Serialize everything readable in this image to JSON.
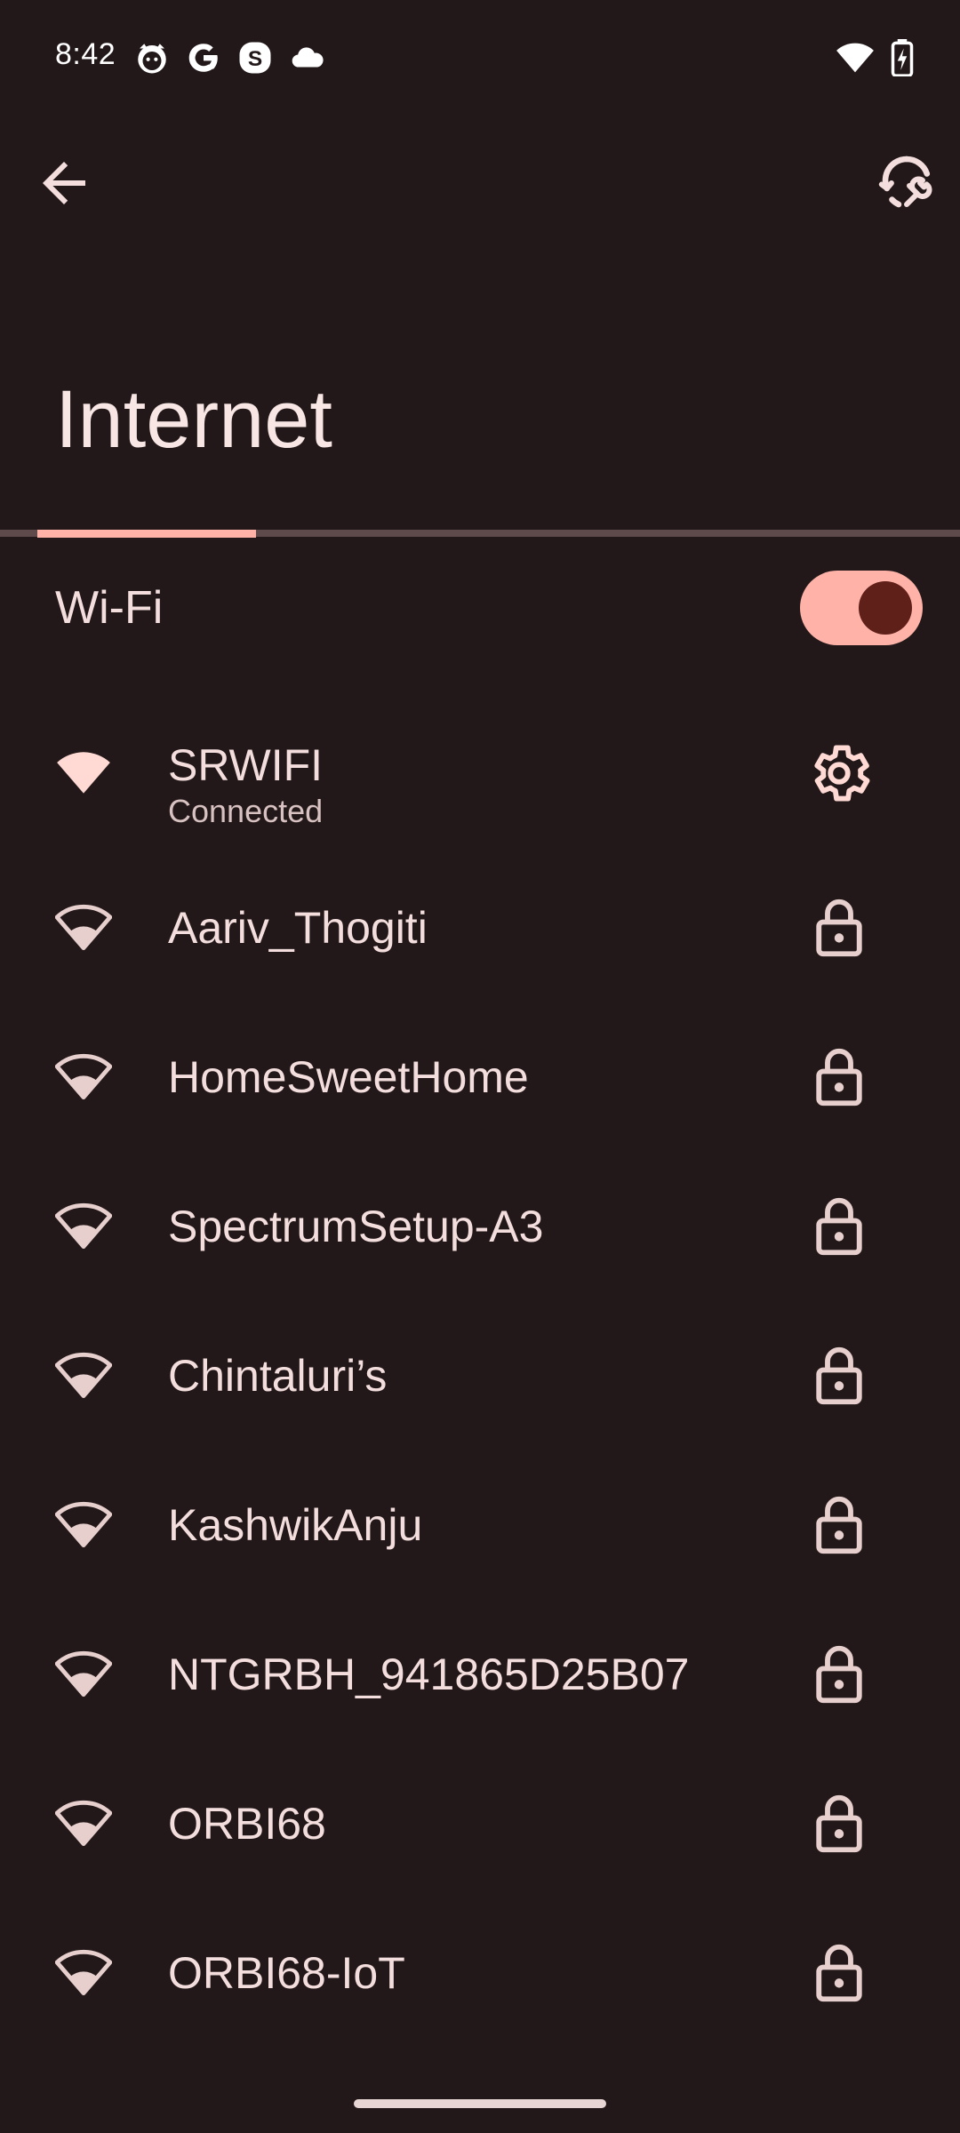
{
  "status_bar": {
    "time": "8:42",
    "left_icons": [
      "cat-app-icon",
      "google-icon",
      "skype-icon",
      "cloud-icon"
    ],
    "right_icons": [
      "wifi-signal-icon",
      "battery-charging-icon"
    ]
  },
  "top_bar": {
    "back_icon": "arrow-back-icon",
    "tools_icon": "network-tools-icon"
  },
  "page": {
    "title": "Internet",
    "scan_progress": 0.17
  },
  "wifi": {
    "label": "Wi-Fi",
    "enabled": true
  },
  "networks": [
    {
      "name": "SRWIFI",
      "status": "Connected",
      "action_icon": "gear-icon",
      "signal": "full"
    },
    {
      "name": "Aariv_Thogiti",
      "action_icon": "lock-icon",
      "signal": "partial"
    },
    {
      "name": "HomeSweetHome",
      "action_icon": "lock-icon",
      "signal": "partial"
    },
    {
      "name": "SpectrumSetup-A3",
      "action_icon": "lock-icon",
      "signal": "partial"
    },
    {
      "name": "Chintaluri’s",
      "action_icon": "lock-icon",
      "signal": "partial"
    },
    {
      "name": "KashwikAnju",
      "action_icon": "lock-icon",
      "signal": "partial"
    },
    {
      "name": "NTGRBH_941865D25B07",
      "action_icon": "lock-icon",
      "signal": "partial"
    },
    {
      "name": "ORBI68",
      "action_icon": "lock-icon",
      "signal": "partial"
    },
    {
      "name": "ORBI68-IoT",
      "action_icon": "lock-icon",
      "signal": "partial"
    }
  ],
  "colors": {
    "background": "#221819",
    "accent": "#ffb3a8",
    "switch_knob": "#5f2019",
    "text": "#f3dedd"
  }
}
